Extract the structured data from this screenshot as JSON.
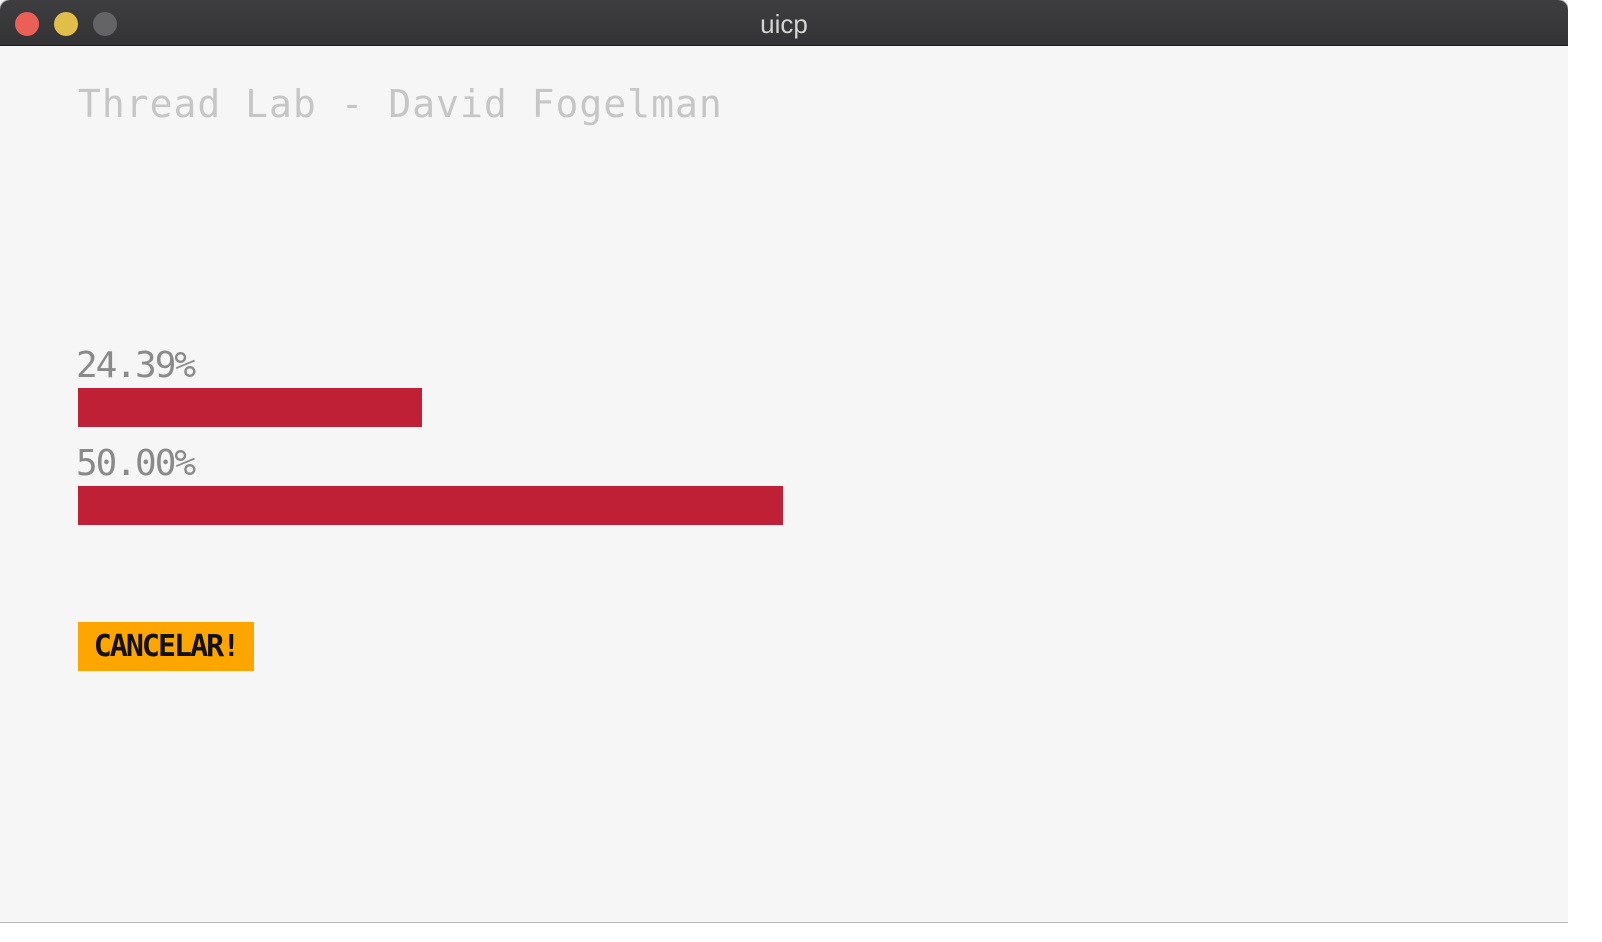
{
  "window": {
    "title": "uicp",
    "controls": [
      "close",
      "minimize",
      "maximize"
    ]
  },
  "app": {
    "title": "Thread Lab - David Fogelman"
  },
  "progress": [
    {
      "label": "24.39%",
      "value": 0.2439,
      "color": "#bf2036"
    },
    {
      "label": "50.00%",
      "value": 0.5,
      "color": "#bf2036"
    }
  ],
  "cancel_button": {
    "label": "CANCELAR!",
    "color": "#ffa500"
  }
}
